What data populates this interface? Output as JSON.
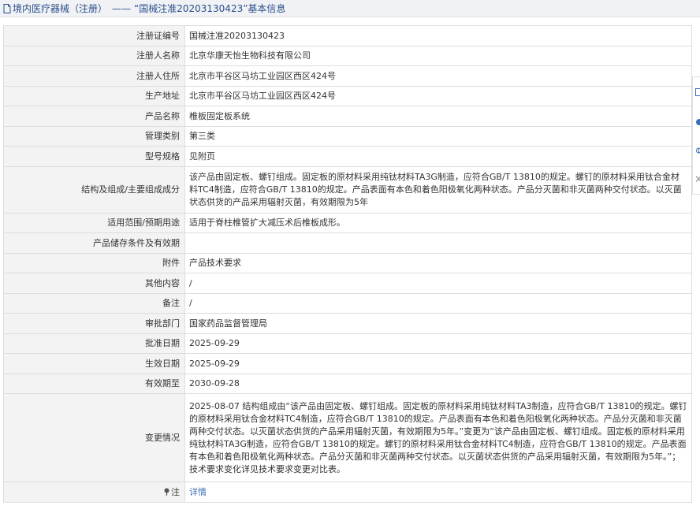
{
  "header": {
    "category": "境内医疗器械（注册）",
    "separator": "——",
    "record_title": "“国械注准20203130423”基本信息"
  },
  "rows": [
    {
      "label": "注册证编号",
      "value": "国械注准20203130423"
    },
    {
      "label": "注册人名称",
      "value": "北京华康天怡生物科技有限公司"
    },
    {
      "label": "注册人住所",
      "value": "北京市平谷区马坊工业园区西区424号"
    },
    {
      "label": "生产地址",
      "value": "北京市平谷区马坊工业园区西区424号"
    },
    {
      "label": "产品名称",
      "value": "椎板固定板系统"
    },
    {
      "label": "管理类别",
      "value": "第三类"
    },
    {
      "label": "型号规格",
      "value": "见附页"
    },
    {
      "label": "结构及组成/主要组成成分",
      "value": "该产品由固定板、螺钉组成。固定板的原材料采用纯钛材料TA3G制造，应符合GB/T 13810的规定。螺钉的原材料采用钛合金材料TC4制造，应符合GB/T 13810的规定。产品表面有本色和着色阳极氧化两种状态。产品分灭菌和非灭菌两种交付状态。以灭菌状态供货的产品采用辐射灭菌，有效期限为5年"
    },
    {
      "label": "适用范围/预期用途",
      "value": "适用于脊柱椎管扩大减压术后椎板成形。"
    },
    {
      "label": "产品储存条件及有效期",
      "value": ""
    },
    {
      "label": "附件",
      "value": "产品技术要求"
    },
    {
      "label": "其他内容",
      "value": "/"
    },
    {
      "label": "备注",
      "value": "/"
    },
    {
      "label": "审批部门",
      "value": "国家药品监督管理局"
    },
    {
      "label": "批准日期",
      "value": "2025-09-29"
    },
    {
      "label": "生效日期",
      "value": "2025-09-29"
    },
    {
      "label": "有效期至",
      "value": "2030-09-28"
    },
    {
      "label": "变更情况",
      "value": "2025-08-07 结构组成由“该产品由固定板、螺钉组成。固定板的原材料采用纯钛材料TA3制造，应符合GB/T 13810的规定。螺钉的原材料采用钛合金材料TC4制造，应符合GB/T 13810的规定。产品表面有本色和着色阳极氧化两种状态。产品分灭菌和非灭菌两种交付状态。以灭菌状态供货的产品采用辐射灭菌，有效期限为5年。”变更为“该产品由固定板、螺钉组成。固定板的原材料采用纯钛材料TA3G制造，应符合GB/T 13810的规定。螺钉的原材料采用钛合金材料TC4制造，应符合GB/T 13810的规定。产品表面有本色和着色阳极氧化两种状态。产品分灭菌和非灭菌两种交付状态。以灭菌状态供货的产品采用辐射灭菌，有效期限为5年。”；技术要求变化详见技术要求变更对比表。"
    }
  ],
  "note": {
    "label": "注",
    "link_text": "详情",
    "icon": "pin-icon"
  },
  "colors": {
    "label_bg": "#f3f3f3",
    "border": "#dddddd",
    "link": "#3a6fb6",
    "title": "#2a4f8a"
  }
}
